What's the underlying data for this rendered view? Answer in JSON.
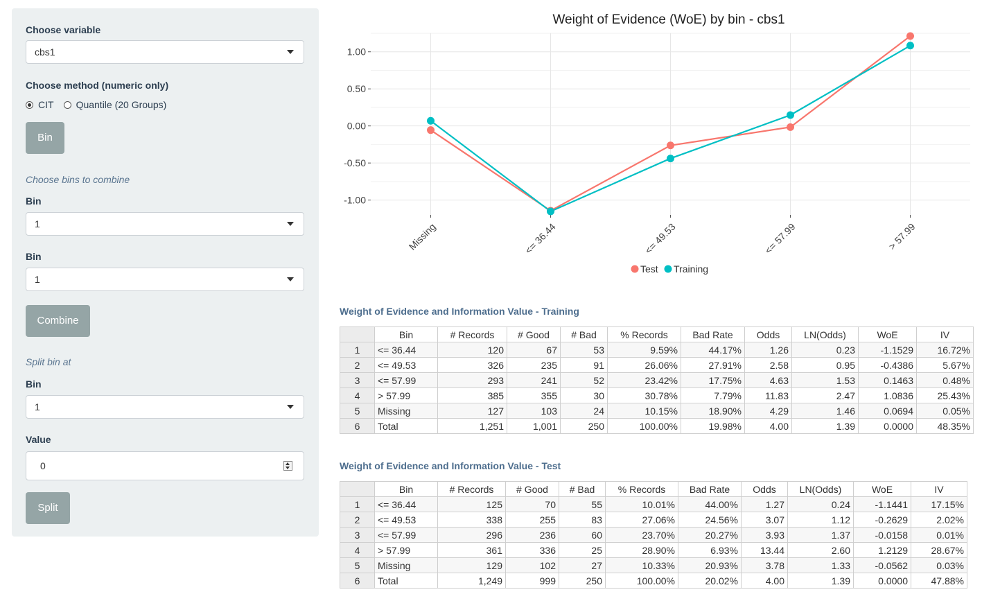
{
  "sidebar": {
    "choose_variable_label": "Choose variable",
    "variable_value": "cbs1",
    "method_label": "Choose method (numeric only)",
    "method_options": [
      "CIT",
      "Quantile (20 Groups)"
    ],
    "method_selected": "CIT",
    "bin_button": "Bin",
    "combine_heading": "Choose bins to combine",
    "bin_label_1": "Bin",
    "bin_value_1": "1",
    "bin_label_2": "Bin",
    "bin_value_2": "1",
    "combine_button": "Combine",
    "split_heading": "Split bin at",
    "bin_label_3": "Bin",
    "bin_value_3": "1",
    "value_label": "Value",
    "value_input": "0",
    "split_button": "Split"
  },
  "chart_data": {
    "type": "line",
    "title": "Weight of Evidence (WoE) by bin - cbs1",
    "categories": [
      "Missing",
      "<= 36.44",
      "<= 49.53",
      "<= 57.99",
      "> 57.99"
    ],
    "y_ticks": [
      "1.00",
      "0.50",
      "0.00",
      "-0.50",
      "-1.00"
    ],
    "ylim": [
      -1.2,
      1.25
    ],
    "grid": true,
    "legend_position": "bottom",
    "series": [
      {
        "name": "Test",
        "color": "#f8766d",
        "values": [
          -0.0562,
          -1.1441,
          -0.2629,
          -0.0158,
          1.2129
        ]
      },
      {
        "name": "Training",
        "color": "#00bfc4",
        "values": [
          0.0694,
          -1.1529,
          -0.4386,
          0.1463,
          1.0836
        ]
      }
    ]
  },
  "training": {
    "title": "Weight of Evidence and Information Value - Training",
    "headers": [
      "",
      "Bin",
      "# Records",
      "# Good",
      "# Bad",
      "% Records",
      "Bad Rate",
      "Odds",
      "LN(Odds)",
      "WoE",
      "IV"
    ],
    "rows": [
      [
        "1",
        "<= 36.44",
        "120",
        "67",
        "53",
        "9.59%",
        "44.17%",
        "1.26",
        "0.23",
        "-1.1529",
        "16.72%"
      ],
      [
        "2",
        "<= 49.53",
        "326",
        "235",
        "91",
        "26.06%",
        "27.91%",
        "2.58",
        "0.95",
        "-0.4386",
        "5.67%"
      ],
      [
        "3",
        "<= 57.99",
        "293",
        "241",
        "52",
        "23.42%",
        "17.75%",
        "4.63",
        "1.53",
        "0.1463",
        "0.48%"
      ],
      [
        "4",
        "> 57.99",
        "385",
        "355",
        "30",
        "30.78%",
        "7.79%",
        "11.83",
        "2.47",
        "1.0836",
        "25.43%"
      ],
      [
        "5",
        "Missing",
        "127",
        "103",
        "24",
        "10.15%",
        "18.90%",
        "4.29",
        "1.46",
        "0.0694",
        "0.05%"
      ],
      [
        "6",
        "Total",
        "1,251",
        "1,001",
        "250",
        "100.00%",
        "19.98%",
        "4.00",
        "1.39",
        "0.0000",
        "48.35%"
      ]
    ]
  },
  "test": {
    "title": "Weight of Evidence and Information Value - Test",
    "headers": [
      "",
      "Bin",
      "# Records",
      "# Good",
      "# Bad",
      "% Records",
      "Bad Rate",
      "Odds",
      "LN(Odds)",
      "WoE",
      "IV"
    ],
    "rows": [
      [
        "1",
        "<= 36.44",
        "125",
        "70",
        "55",
        "10.01%",
        "44.00%",
        "1.27",
        "0.24",
        "-1.1441",
        "17.15%"
      ],
      [
        "2",
        "<= 49.53",
        "338",
        "255",
        "83",
        "27.06%",
        "24.56%",
        "3.07",
        "1.12",
        "-0.2629",
        "2.02%"
      ],
      [
        "3",
        "<= 57.99",
        "296",
        "236",
        "60",
        "23.70%",
        "20.27%",
        "3.93",
        "1.37",
        "-0.0158",
        "0.01%"
      ],
      [
        "4",
        "> 57.99",
        "361",
        "336",
        "25",
        "28.90%",
        "6.93%",
        "13.44",
        "2.60",
        "1.2129",
        "28.67%"
      ],
      [
        "5",
        "Missing",
        "129",
        "102",
        "27",
        "10.33%",
        "20.93%",
        "3.78",
        "1.33",
        "-0.0562",
        "0.03%"
      ],
      [
        "6",
        "Total",
        "1,249",
        "999",
        "250",
        "100.00%",
        "20.02%",
        "4.00",
        "1.39",
        "0.0000",
        "47.88%"
      ]
    ]
  }
}
